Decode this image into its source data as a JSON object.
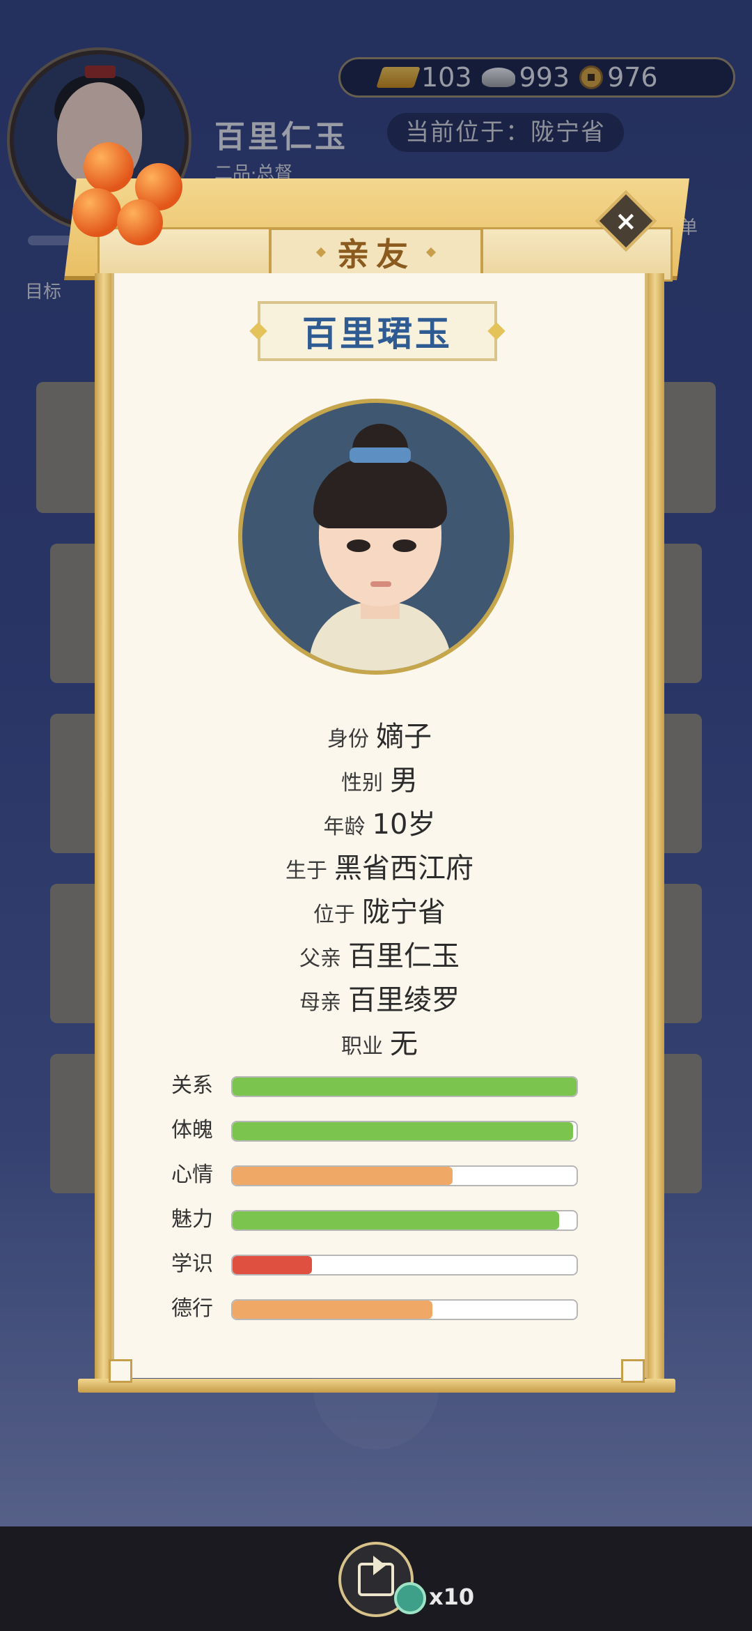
{
  "hud": {
    "player_name": "百里仁玉",
    "player_rank": "二品·总督",
    "location_text": "当前位于：陇宁省",
    "currency": {
      "gold": "103",
      "silver": "993",
      "coin": "976"
    },
    "target_label": "目标",
    "menu_label": "菜单"
  },
  "modal": {
    "title": "亲友",
    "person_name": "百里珺玉",
    "info": [
      {
        "label": "身份",
        "value": "嫡子"
      },
      {
        "label": "性别",
        "value": "男"
      },
      {
        "label": "年龄",
        "value": "10岁"
      },
      {
        "label": "生于",
        "value": "黑省西江府"
      },
      {
        "label": "位于",
        "value": "陇宁省"
      },
      {
        "label": "父亲",
        "value": "百里仁玉"
      },
      {
        "label": "母亲",
        "value": "百里绫罗"
      },
      {
        "label": "职业",
        "value": "无"
      }
    ],
    "stats": [
      {
        "label": "关系",
        "level": 1.0,
        "color": "#7bc54f"
      },
      {
        "label": "体魄",
        "level": 0.99,
        "color": "#7bc54f"
      },
      {
        "label": "心情",
        "level": 0.64,
        "color": "#f0a866"
      },
      {
        "label": "魅力",
        "level": 0.95,
        "color": "#7bc54f"
      },
      {
        "label": "学识",
        "level": 0.23,
        "color": "#e05040"
      },
      {
        "label": "德行",
        "level": 0.58,
        "color": "#f0a866"
      }
    ]
  },
  "bottom": {
    "reward_count": "x10"
  }
}
